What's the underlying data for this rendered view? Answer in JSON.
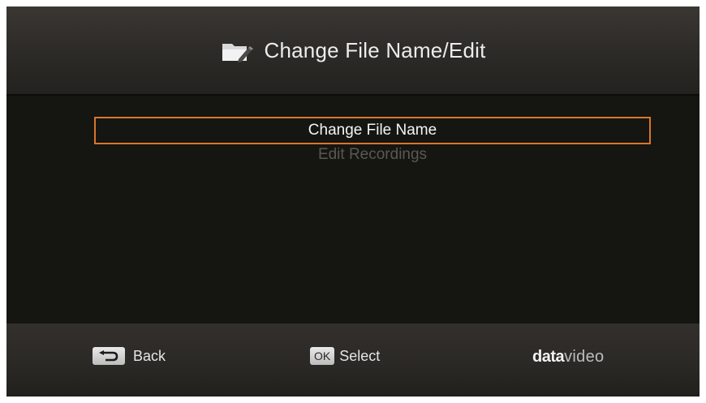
{
  "header": {
    "title": "Change File Name/Edit",
    "icon": "folder-edit-icon"
  },
  "menu": {
    "items": [
      {
        "label": "Change File Name",
        "state": "selected"
      },
      {
        "label": "Edit Recordings",
        "state": "disabled"
      }
    ]
  },
  "footer": {
    "back": {
      "key_icon": "back-arrow-icon",
      "label": "Back"
    },
    "select": {
      "key": "OK",
      "label": "Select"
    },
    "logo": {
      "bold": "data",
      "light": "video"
    }
  },
  "colors": {
    "background": "#151512",
    "selection_border": "#d8772b",
    "text_primary": "#f4f4f4",
    "text_disabled": "#595852"
  }
}
